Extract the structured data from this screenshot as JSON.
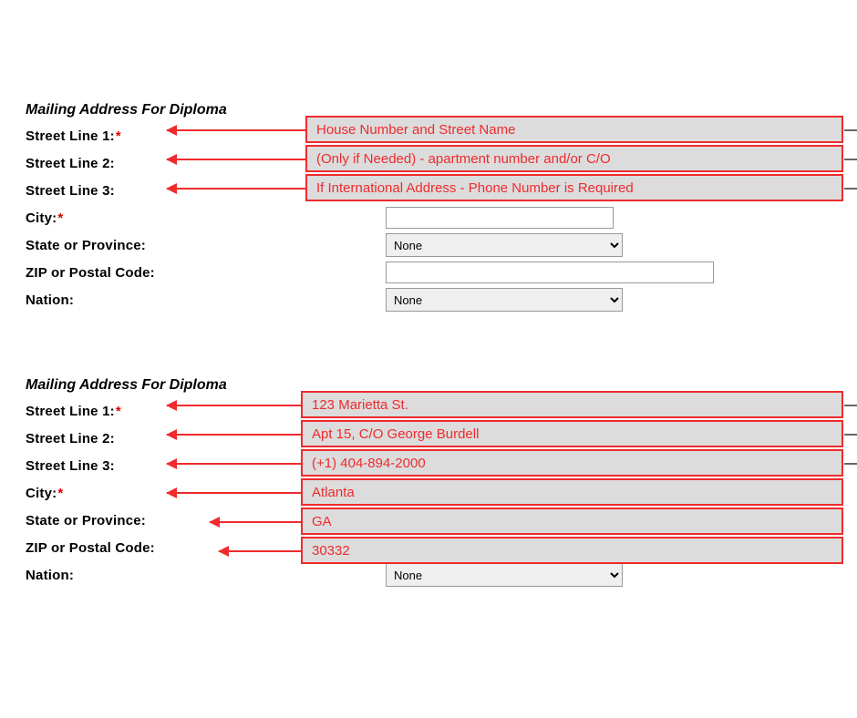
{
  "section1": {
    "heading": "Mailing Address For Diploma",
    "labels": {
      "street1": "Street Line 1:",
      "street2": "Street Line 2:",
      "street3": "Street Line 3:",
      "city": "City:",
      "state": "State or Province:",
      "zip": "ZIP or Postal Code:",
      "nation": "Nation:"
    },
    "required_mark": "*",
    "selects": {
      "state_value": "None",
      "nation_value": "None"
    },
    "annotations": {
      "a1": "House Number and Street Name",
      "a2": "(Only if Needed) - apartment number and/or C/O",
      "a3": "If International Address - Phone Number is Required"
    }
  },
  "section2": {
    "heading": "Mailing Address For Diploma",
    "labels": {
      "street1": "Street Line 1:",
      "street2": "Street Line 2:",
      "street3": "Street Line 3:",
      "city": "City:",
      "state": "State or Province:",
      "zip": "ZIP or Postal Code:",
      "nation": "Nation:"
    },
    "required_mark": "*",
    "selects": {
      "nation_value": "None"
    },
    "annotations": {
      "a1": "123 Marietta St.",
      "a2": "Apt 15, C/O George Burdell",
      "a3": "(+1) 404-894-2000",
      "a4": "Atlanta",
      "a5": "GA",
      "a6": "30332"
    }
  }
}
